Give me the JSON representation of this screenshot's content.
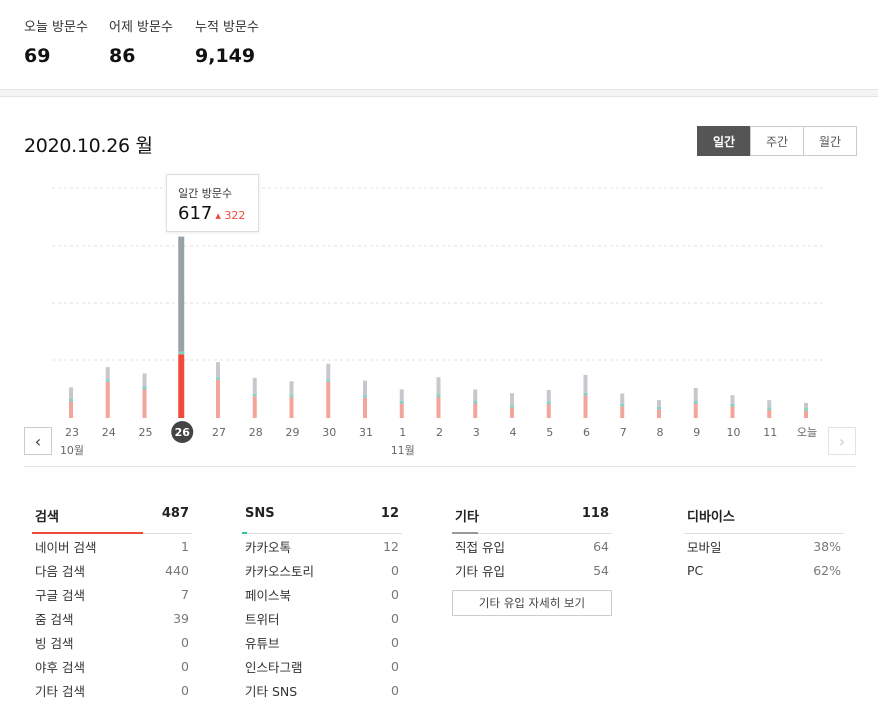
{
  "summary": [
    {
      "label": "오늘 방문수",
      "value": "69"
    },
    {
      "label": "어제 방문수",
      "value": "86"
    },
    {
      "label": "누적 방문수",
      "value": "9,149"
    }
  ],
  "date_title": "2020.10.26 월",
  "period_tabs": [
    {
      "label": "일간",
      "active": true
    },
    {
      "label": "주간",
      "active": false
    },
    {
      "label": "월간",
      "active": false
    }
  ],
  "tooltip": {
    "label": "일간 방문수",
    "value": "617",
    "increase": "322"
  },
  "nav": {
    "prev_icon": "chevron-left-icon",
    "next_icon": "chevron-right-icon"
  },
  "chart_data": {
    "type": "bar",
    "categories": [
      "23",
      "24",
      "25",
      "26",
      "27",
      "28",
      "29",
      "30",
      "31",
      "1",
      "2",
      "3",
      "4",
      "5",
      "6",
      "7",
      "8",
      "9",
      "10",
      "11",
      "오늘"
    ],
    "month_labels": [
      {
        "at": "23",
        "label": "10월"
      },
      {
        "at": "1",
        "label": "11월"
      }
    ],
    "selected": "26",
    "series": [
      {
        "values": [
          57,
          125,
          100,
          220,
          132,
          75,
          73,
          125,
          70,
          50,
          73,
          50,
          35,
          48,
          78,
          40,
          30,
          50,
          40,
          28,
          25
        ],
        "color": "#f4a59b",
        "selected_color": "#f04a3a"
      },
      {
        "values": [
          0,
          0,
          0,
          0,
          0,
          0,
          0,
          0,
          0,
          0,
          0,
          0,
          0,
          0,
          0,
          0,
          0,
          0,
          0,
          0,
          0
        ],
        "color": "#7fd3c3"
      },
      {
        "values": [
          40,
          42,
          45,
          397,
          52,
          55,
          45,
          53,
          50,
          40,
          59,
          40,
          42,
          40,
          62,
          36,
          23,
          45,
          30,
          25,
          18
        ],
        "color": "#c5c8cc",
        "selected_color": "#99a1a9"
      }
    ],
    "grid": true
  },
  "sources": [
    {
      "title": "검색",
      "total": "487",
      "accent": "#f04a3a",
      "fill": 0.85,
      "rows": [
        {
          "label": "네이버 검색",
          "value": "1"
        },
        {
          "label": "다음 검색",
          "value": "440"
        },
        {
          "label": "구글 검색",
          "value": "7"
        },
        {
          "label": "줌 검색",
          "value": "39"
        },
        {
          "label": "빙 검색",
          "value": "0"
        },
        {
          "label": "야후 검색",
          "value": "0"
        },
        {
          "label": "기타 검색",
          "value": "0"
        }
      ]
    },
    {
      "title": "SNS",
      "total": "12",
      "accent": "#2bc79a",
      "fill": 0.04,
      "rows": [
        {
          "label": "카카오톡",
          "value": "12"
        },
        {
          "label": "카카오스토리",
          "value": "0"
        },
        {
          "label": "페이스북",
          "value": "0"
        },
        {
          "label": "트위터",
          "value": "0"
        },
        {
          "label": "유튜브",
          "value": "0"
        },
        {
          "label": "인스타그램",
          "value": "0"
        },
        {
          "label": "기타 SNS",
          "value": "0"
        }
      ]
    },
    {
      "title": "기타",
      "total": "118",
      "accent": "#999999",
      "fill": 0.2,
      "rows": [
        {
          "label": "직접 유입",
          "value": "64"
        },
        {
          "label": "기타 유입",
          "value": "54"
        }
      ],
      "button": "기타 유입 자세히 보기"
    },
    {
      "title": "디바이스",
      "total": "",
      "accent": "#dddddd",
      "fill": 0,
      "rows": [
        {
          "label": "모바일",
          "value": "38%"
        },
        {
          "label": "PC",
          "value": "62%"
        }
      ]
    }
  ]
}
